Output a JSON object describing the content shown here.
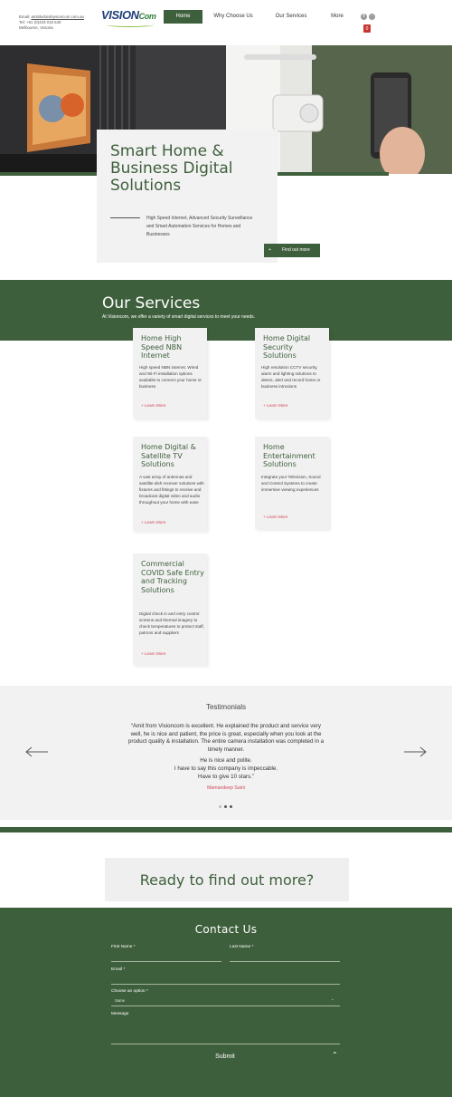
{
  "header": {
    "contact_email_label": "Email:",
    "contact_email": "ambikafoisibysioncom.com.au",
    "contact_phone": "Tel: +61 (0)433 015 540",
    "contact_location": "Melbourne, Victoria",
    "logo_vision": "VISION",
    "logo_com": "Com",
    "nav": [
      "Home",
      "Why Choose Us",
      "Our Services",
      "More"
    ],
    "cart_count": "0"
  },
  "hero": {
    "title": "Smart Home & Business Digital Solutions",
    "description": "High Speed Internet, Advanced Security Surveillance and Smart Automation Services for Homes and Businesses",
    "button_label": "Find out more",
    "button_icon": "+"
  },
  "services": {
    "title": "Our Services",
    "subtitle": "At Visioncom, we offer a variety of smart digital services to meet your needs.",
    "learn_more": "+ Learn More",
    "items": [
      {
        "title": "Home High Speed NBN Internet",
        "desc": "High speed NBN internet, Wired and Wi-Fi installation options available to connect your home or business"
      },
      {
        "title": "Home Digital Security Solutions",
        "desc": "High resolution CCTV security, alarm and lighting solutions to detect, alert and record home or business intrusions"
      },
      {
        "title": "Home Digital & Satellite TV Solutions",
        "desc": "A vast array of antennas and satellite dish receiver solutions with fixtures and fittings to receive and broadcast digital video and audio throughout your home with ease"
      },
      {
        "title": "Home Entertainment Solutions",
        "desc": "Integrate your Television, Sound and Control Systems to create immersive viewing experiences"
      },
      {
        "title": "Commercial COVID Safe Entry and Tracking Solutions",
        "desc": "Digital check in and entry control screens and thermal imagery to check temperatures to protect staff, patrons and suppliers"
      }
    ]
  },
  "testimonials": {
    "title": "Testimonials",
    "quote_1": "“Amit from Visioncom is excellent. He explained the product and service very well, he is nice and patient, the price is great, especially when you look at the product quality & installation. The entire camera installation was completed in a timely manner.",
    "quote_2": "He is nice and polite.",
    "quote_3": "I have to say this company is impeccable.",
    "quote_4": "Have to give 10 stars.”",
    "author": "Mamandeep Saini",
    "active_slide": 2,
    "slide_count": 3
  },
  "cta": {
    "text": "Ready to find out more?"
  },
  "contact": {
    "title": "Contact Us",
    "first_name_label": "First Name *",
    "last_name_label": "Last Name *",
    "email_label": "Email *",
    "choose_label": "Choose an option *",
    "choose_value": "Same",
    "message_label": "Message",
    "submit_label": "Submit"
  },
  "colors": {
    "brand_green": "#3e5f3c",
    "accent_red": "#d04a5a",
    "logo_blue": "#1f3f7a"
  },
  "icons": {
    "facebook": "facebook-icon",
    "social_2": "instagram-icon",
    "cart": "cart-icon",
    "prev": "arrow-left-icon",
    "next": "arrow-right-icon",
    "up": "chevron-up-icon"
  }
}
